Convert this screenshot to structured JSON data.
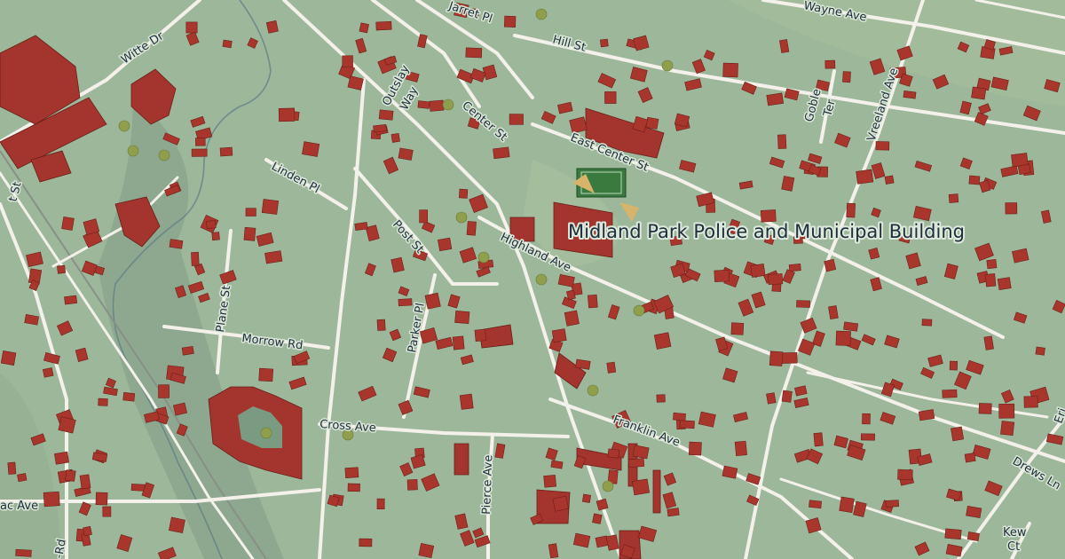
{
  "map": {
    "style": "topographic-satellite-hybrid",
    "colors": {
      "land": "#9db79a",
      "road": "#f3f1ea",
      "building": "#a8362c",
      "label": "#1f2e3d"
    }
  },
  "poi": {
    "name": "Midland Park Police and Municipal Building"
  },
  "streets": {
    "witte_dr": "Witte Dr",
    "jarret_pl": "Jarret Pl",
    "hill_st": "Hill St",
    "wayne_ave": "Wayne Ave",
    "outslay_way_1": "Outslay",
    "outslay_way_2": "Way",
    "center_st": "Center St",
    "east_center_st": "East Center St",
    "goble_ter_1": "Goble",
    "goble_ter_2": "Ter",
    "vreeland_ave": "Vreeland Ave",
    "linden_pl": "Linden Pl",
    "post_st": "Post St",
    "highland_ave": "Highland Ave",
    "plane_st": "Plane St",
    "morrow_rd": "Morrow Rd",
    "parker_pl": "Parker Pl",
    "cross_ave": "Cross Ave",
    "franklin_ave": "Franklin Ave",
    "pierce_ave": "Pierce Ave",
    "drews_ln": "Drews Ln",
    "kew_ct_1": "Kew",
    "kew_ct_2": "Ct",
    "left_st_fragment": "t St",
    "mac_ave_fragment": "ac Ave",
    "rd_fragment": "-Rd",
    "right_edge_fragment": "Eri"
  }
}
